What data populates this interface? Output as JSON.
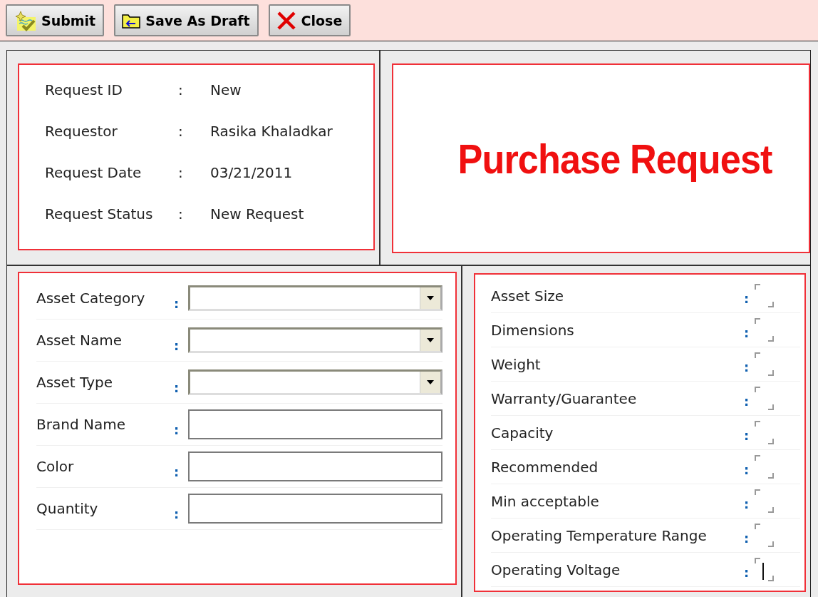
{
  "toolbar": [
    {
      "kind": "submit",
      "label": "Submit"
    },
    {
      "kind": "draft",
      "label": "Save As Draft"
    },
    {
      "kind": "close",
      "label": "Close"
    }
  ],
  "request_info": [
    {
      "label": "Request ID",
      "separator": ":",
      "value": "New"
    },
    {
      "label": "Requestor",
      "separator": ":",
      "value": "Rasika Khaladkar"
    },
    {
      "label": "Request Date",
      "separator": ":",
      "value": "03/21/2011"
    },
    {
      "label": "Request Status",
      "separator": ":",
      "value": "New Request"
    }
  ],
  "title": "Purchase Request",
  "asset_fields": [
    {
      "label": "Asset Category",
      "separator": ":",
      "kind": "dropdown"
    },
    {
      "label": "Asset Name",
      "separator": ":",
      "kind": "dropdown"
    },
    {
      "label": "Asset Type",
      "separator": ":",
      "kind": "dropdown"
    },
    {
      "label": "Brand Name",
      "separator": ":",
      "kind": "text"
    },
    {
      "label": "Color",
      "separator": ":",
      "kind": "text"
    },
    {
      "label": "Quantity",
      "separator": ":",
      "kind": "text"
    }
  ],
  "spec_fields": [
    {
      "label": "Asset Size",
      "separator": ":",
      "focused": false
    },
    {
      "label": "Dimensions",
      "separator": ":",
      "focused": false
    },
    {
      "label": "Weight",
      "separator": ":",
      "focused": false
    },
    {
      "label": "Warranty/Guarantee",
      "separator": ":",
      "focused": false
    },
    {
      "label": "Capacity",
      "separator": ":",
      "focused": false
    },
    {
      "label": "Recommended",
      "separator": ":",
      "focused": false
    },
    {
      "label": "Min acceptable",
      "separator": ":",
      "focused": false
    },
    {
      "label": "Operating Temperature Range",
      "separator": ":",
      "focused": false
    },
    {
      "label": "Operating Voltage",
      "separator": ":",
      "focused": true
    }
  ]
}
